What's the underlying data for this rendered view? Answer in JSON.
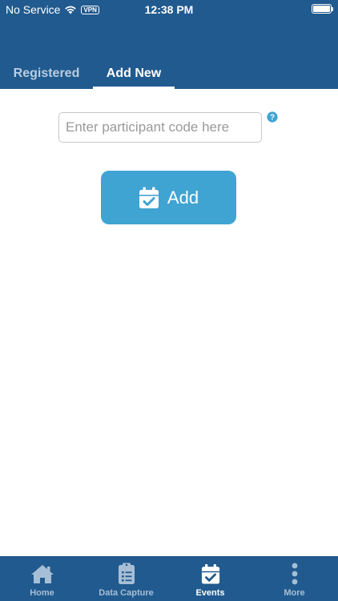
{
  "status_bar": {
    "carrier": "No Service",
    "vpn": "VPN",
    "time": "12:38 PM"
  },
  "tabs": [
    {
      "label": "Registered",
      "active": false
    },
    {
      "label": "Add New",
      "active": true
    }
  ],
  "form": {
    "code_placeholder": "Enter participant code here",
    "code_value": "",
    "help_icon": "question-circle-icon",
    "add_label": "Add",
    "add_icon": "calendar-check-icon"
  },
  "bottom_nav": [
    {
      "label": "Home",
      "icon": "home-icon",
      "active": false
    },
    {
      "label": "Data Capture",
      "icon": "clipboard-list-icon",
      "active": false
    },
    {
      "label": "Events",
      "icon": "calendar-check-icon",
      "active": true
    },
    {
      "label": "More",
      "icon": "more-vertical-icon",
      "active": false
    }
  ],
  "colors": {
    "header": "#215a8e",
    "accent": "#3fa4d2",
    "inactive_tab": "#b9cde0",
    "inactive_nav": "#a7bfd6"
  }
}
